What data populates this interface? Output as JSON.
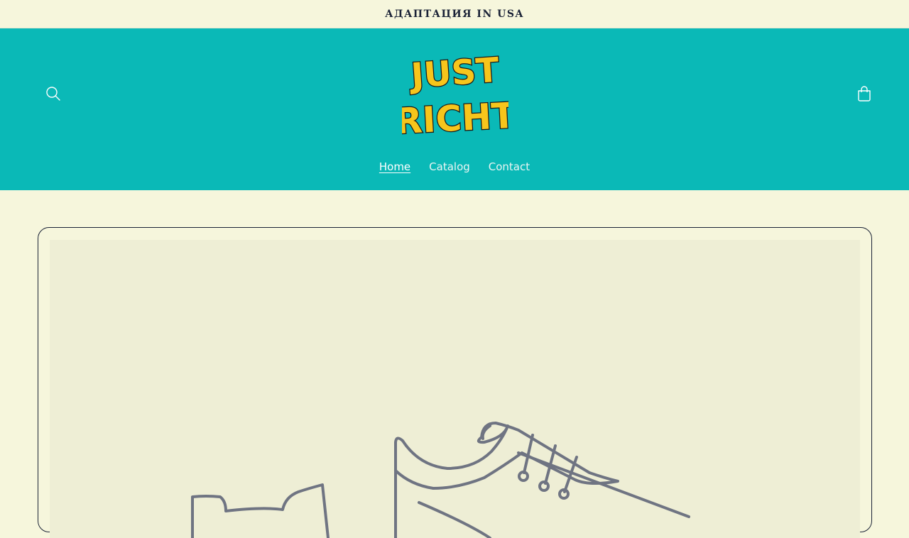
{
  "announcement": {
    "text": "АДАПТАЦИЯ IN USA"
  },
  "header": {
    "logo_alt": "JUST RICHT",
    "logo_line1": "JUST",
    "logo_line2": "RICHT",
    "search_icon": "search-icon",
    "cart_icon": "cart-icon"
  },
  "nav": {
    "items": [
      {
        "label": "Home",
        "active": true
      },
      {
        "label": "Catalog",
        "active": false
      },
      {
        "label": "Contact",
        "active": false
      }
    ]
  },
  "hero": {
    "image": "shoe-placeholder-illustration"
  },
  "colors": {
    "header_bg": "#0ab9b7",
    "page_bg": "#f6f6dc",
    "text": "#1a2236",
    "logo_yellow": "#f7c51c",
    "placeholder_bg": "#eeeed5",
    "placeholder_stroke": "#6f7482"
  }
}
